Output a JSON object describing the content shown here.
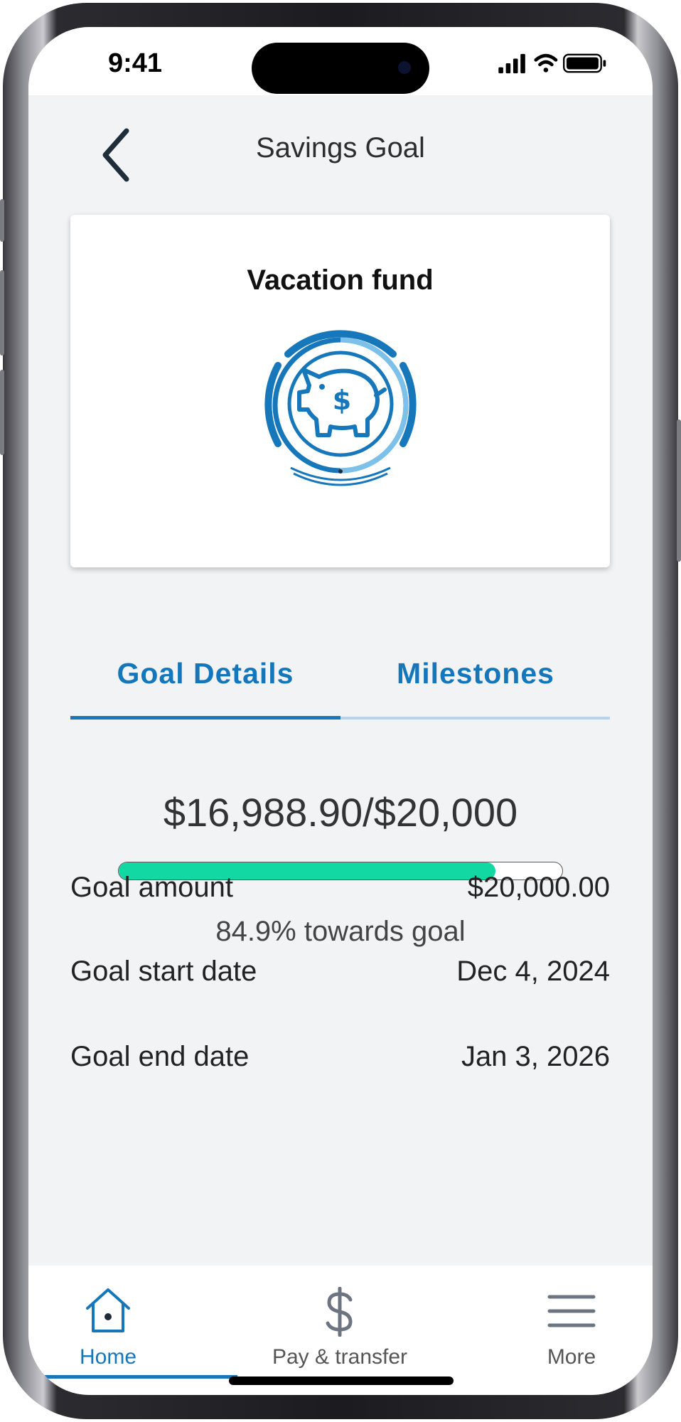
{
  "status_bar": {
    "time": "9:41",
    "icons": [
      "signal-icon",
      "wifi-icon",
      "battery-icon"
    ]
  },
  "header": {
    "title": "Savings Goal",
    "back_icon": "chevron-left-icon"
  },
  "goal_card": {
    "name": "Vacation fund",
    "icon": "piggy-bank-dollar-icon"
  },
  "tabs": [
    {
      "label": "Goal Details",
      "active": true
    },
    {
      "label": "Milestones",
      "active": false
    }
  ],
  "progress": {
    "summary": "$16,988.90/$20,000",
    "fraction": 0.849,
    "text": "84.9% towards goal"
  },
  "details": [
    {
      "label": "Goal amount",
      "value": "$20,000.00"
    },
    {
      "label": "Goal start date",
      "value": "Dec 4, 2024"
    },
    {
      "label": "Goal end date",
      "value": "Jan 3, 2026"
    }
  ],
  "bottom_nav": [
    {
      "label": "Home",
      "icon": "home-icon",
      "active": true
    },
    {
      "label": "Pay & transfer",
      "icon": "dollar-icon",
      "active": false
    },
    {
      "label": "More",
      "icon": "menu-icon",
      "active": false
    }
  ],
  "colors": {
    "accent": "#1677bb",
    "progress_fill": "#12d9a4",
    "background": "#f2f3f5"
  }
}
